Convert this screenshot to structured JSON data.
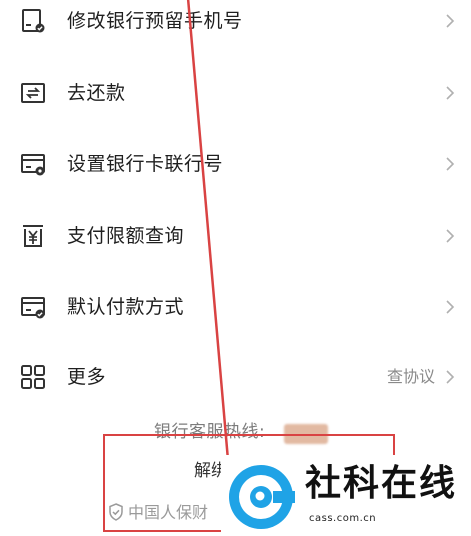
{
  "menu": {
    "items": [
      {
        "icon": "card-edit-icon",
        "label": "修改银行预留手机号"
      },
      {
        "icon": "repay-icon",
        "label": "去还款"
      },
      {
        "icon": "card-settings-icon",
        "label": "设置银行卡联行号"
      },
      {
        "icon": "yuan-limit-icon",
        "label": "支付限额查询"
      },
      {
        "icon": "card-check-icon",
        "label": "默认付款方式"
      },
      {
        "icon": "grid-icon",
        "label": "更多",
        "extra": "查协议"
      }
    ]
  },
  "footer": {
    "hotline_label": "银行客服热线:",
    "unbind_label": "解绑",
    "insurance_text": "中国人保财"
  },
  "watermark": {
    "brand": "社科在线",
    "url": "cass.com.cn"
  },
  "colors": {
    "text": "#1f1f1f",
    "secondary": "#8a8a8a",
    "annotation_red": "#d94343",
    "watermark_blue": "#1fa3e6"
  }
}
